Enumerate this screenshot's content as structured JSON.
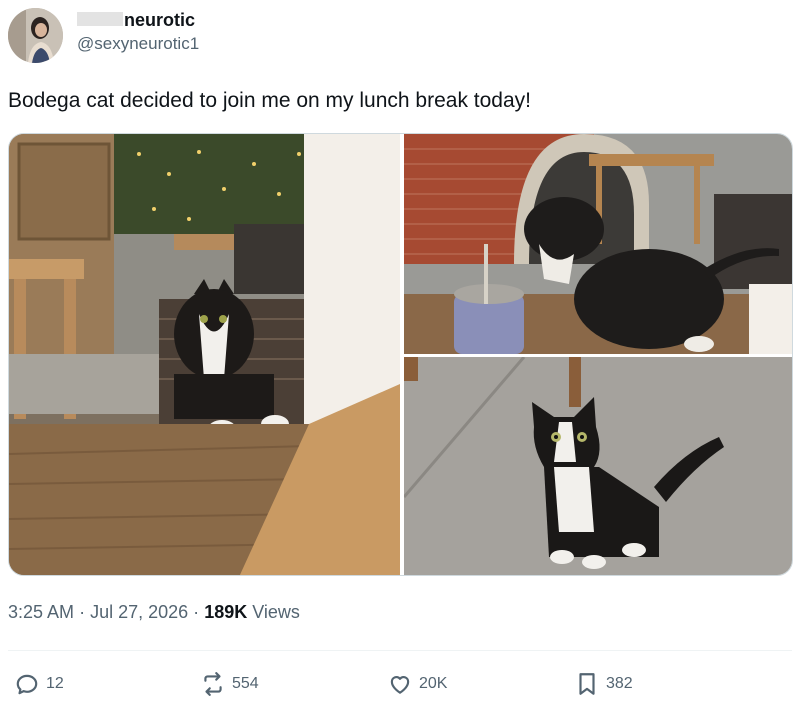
{
  "author": {
    "display_name": "neurotic",
    "handle": "@sexyneurotic1"
  },
  "tweet": {
    "text": "Bodega cat decided to join me on my lunch break today!"
  },
  "meta": {
    "time": "3:25 AM",
    "separator": "·",
    "date": "Jul 27, 2026",
    "views_count": "189K",
    "views_label": "Views"
  },
  "actions": {
    "replies": "12",
    "reposts": "554",
    "likes": "20K",
    "bookmarks": "382"
  },
  "colors": {
    "text_primary": "#0f1419",
    "text_secondary": "#536471",
    "border": "#cfd9de"
  },
  "icons": [
    "reply-icon",
    "repost-icon",
    "like-icon",
    "bookmark-icon"
  ]
}
